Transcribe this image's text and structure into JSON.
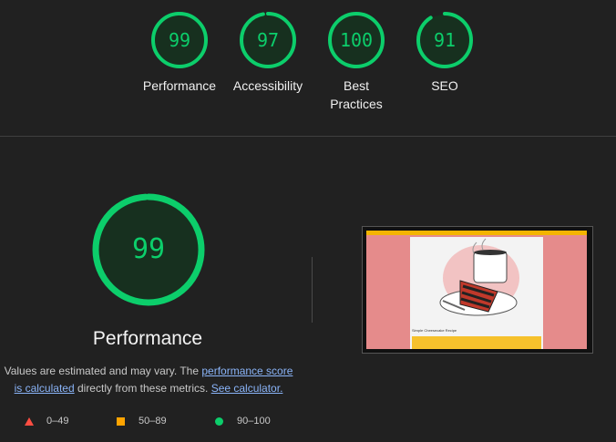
{
  "summary": [
    {
      "score": "99",
      "label": "Performance",
      "fraction": 0.99
    },
    {
      "score": "97",
      "label": "Accessibility",
      "fraction": 0.97
    },
    {
      "score": "100",
      "label": "Best Practices",
      "fraction": 1.0
    },
    {
      "score": "91",
      "label": "SEO",
      "fraction": 0.91
    }
  ],
  "main": {
    "score": "99",
    "fraction": 0.99,
    "title": "Performance",
    "desc_prefix": "Values are estimated and may vary. The ",
    "link_score": "performance score is calculated",
    "desc_mid": " directly from these metrics. ",
    "link_calc": "See calculator."
  },
  "legend": [
    {
      "shape": "triangle",
      "range": "0–49",
      "color": "#ff4e42"
    },
    {
      "shape": "square",
      "range": "50–89",
      "color": "#ffa400"
    },
    {
      "shape": "circle",
      "range": "90–100",
      "color": "#0cce6b"
    }
  ],
  "screenshot": {
    "caption": "Simple Cheesecake Recipe"
  },
  "colors": {
    "pass": "#0cce6b",
    "pass_bg": "#0a3a22"
  }
}
